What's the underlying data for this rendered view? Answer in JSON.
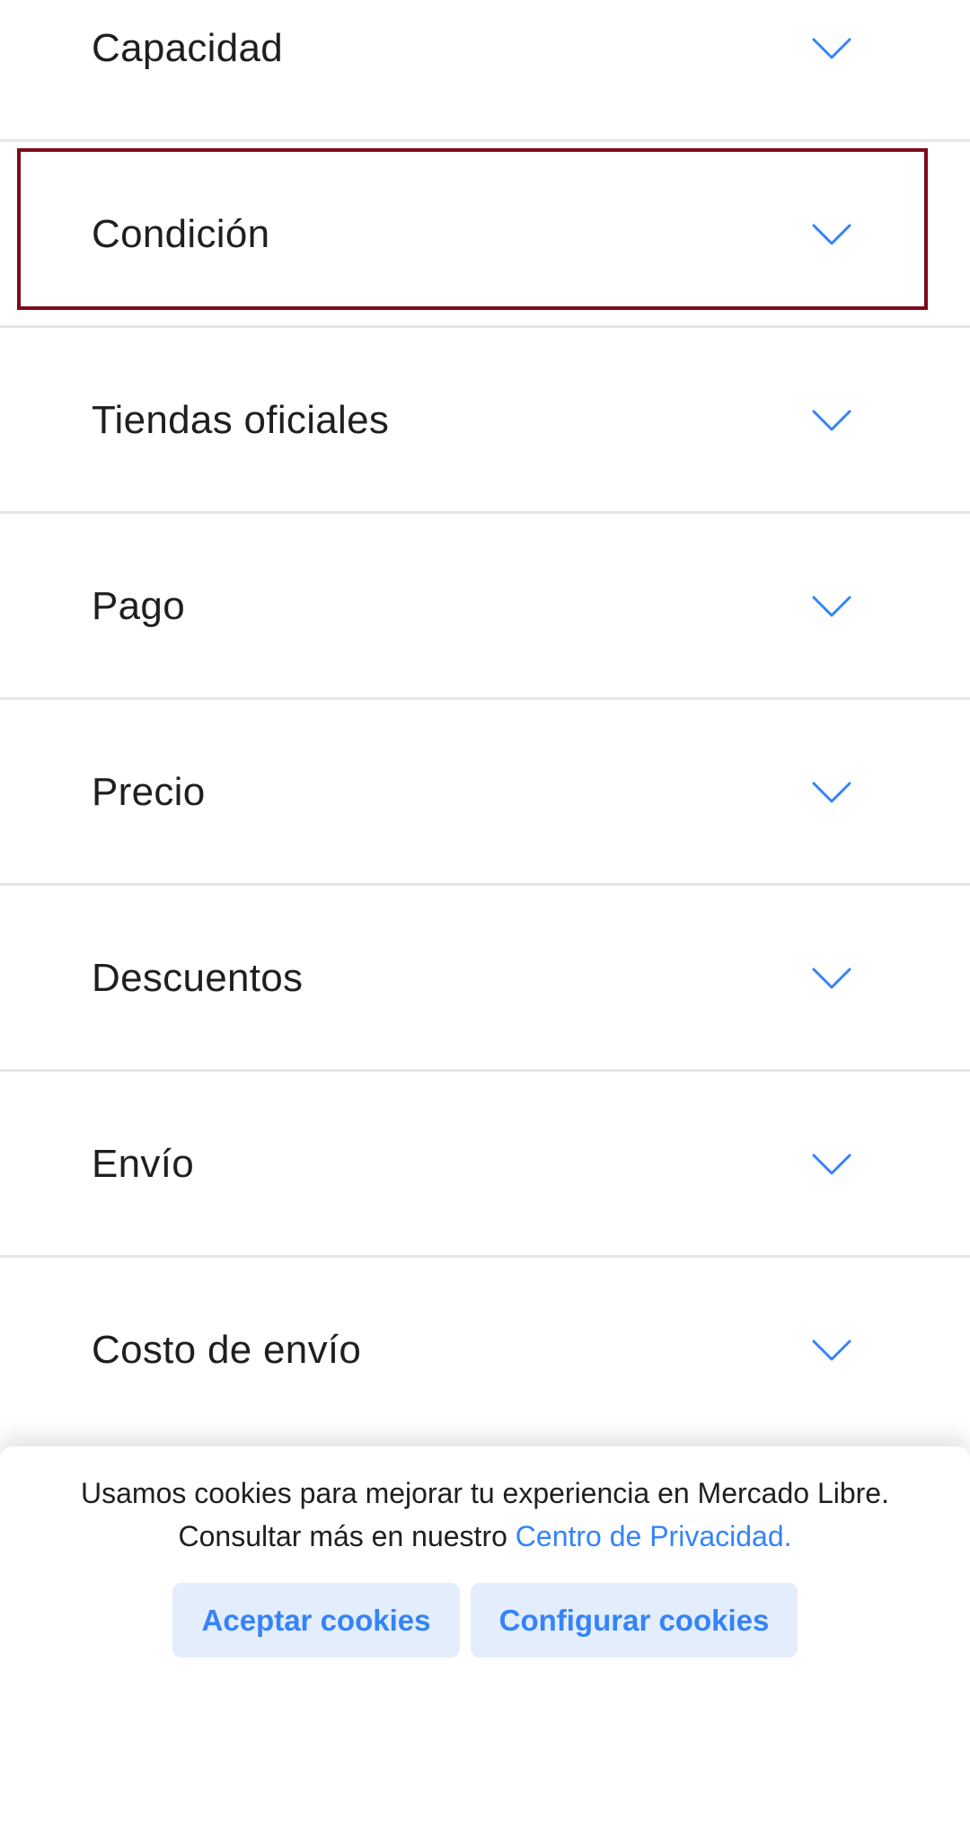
{
  "filters": [
    {
      "label": "Capacidad",
      "icon": "chevron-down-icon"
    },
    {
      "label": "Condición",
      "icon": "chevron-down-icon"
    },
    {
      "label": "Tiendas oficiales",
      "icon": "chevron-down-icon"
    },
    {
      "label": "Pago",
      "icon": "chevron-down-icon"
    },
    {
      "label": "Precio",
      "icon": "chevron-down-icon"
    },
    {
      "label": "Descuentos",
      "icon": "chevron-down-icon"
    },
    {
      "label": "Envío",
      "icon": "chevron-down-icon"
    },
    {
      "label": "Costo de envío",
      "icon": "chevron-down-icon"
    }
  ],
  "cookie_banner": {
    "message": "Usamos cookies para mejorar tu experiencia en Mercado Libre. Consultar más en nuestro",
    "link_text": "Centro de Privacidad.",
    "accept_label": "Aceptar cookies",
    "configure_label": "Configurar cookies"
  },
  "colors": {
    "accent": "#3483fa",
    "button_bg": "#e3edfb",
    "highlight_border": "#7d0a1a",
    "divider": "#e6e6e6",
    "text": "#1f1f1f"
  }
}
